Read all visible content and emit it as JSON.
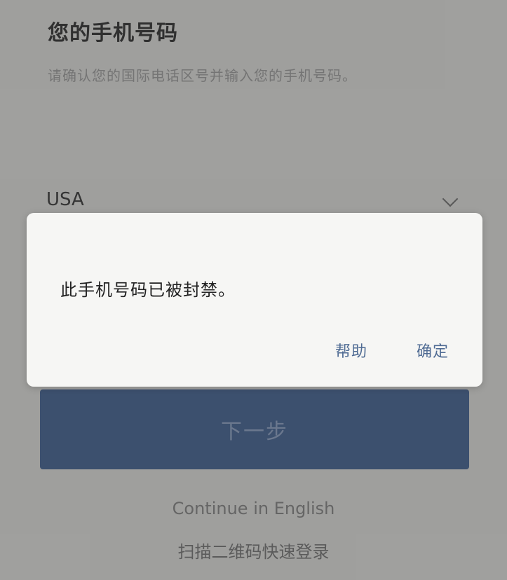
{
  "page": {
    "title": "您的手机号码",
    "subtitle": "请确认您的国际电话区号并输入您的手机号码。",
    "country": "USA",
    "next_label": "下一步",
    "continue_english": "Continue in English",
    "qr_login": "扫描二维码快速登录"
  },
  "dialog": {
    "message": "此手机号码已被封禁。",
    "help_label": "帮助",
    "ok_label": "确定"
  },
  "colors": {
    "primary_button": "#3d5a86",
    "dialog_link": "#4f6b93"
  }
}
